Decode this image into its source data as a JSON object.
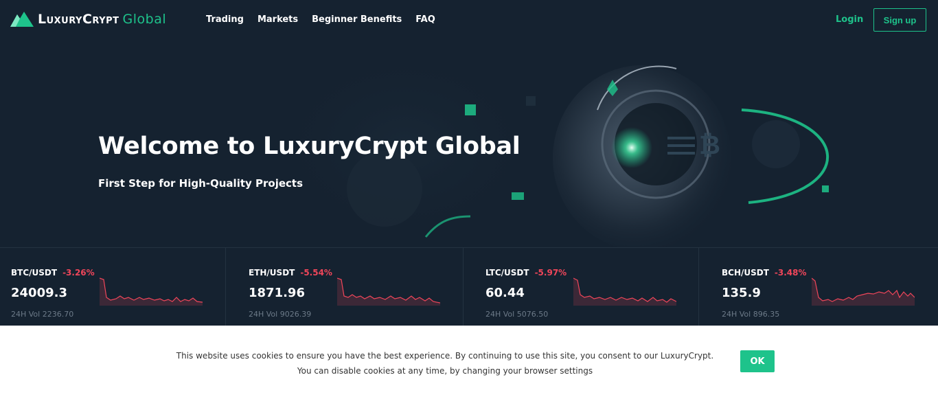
{
  "header": {
    "logo_brand": "LuxuryCrypt",
    "logo_accent": "Global",
    "nav": [
      {
        "label": "Trading"
      },
      {
        "label": "Markets"
      },
      {
        "label": "Beginner Benefits"
      },
      {
        "label": "FAQ"
      }
    ],
    "login_label": "Login",
    "signup_label": "Sign up"
  },
  "hero": {
    "title": "Welcome to LuxuryCrypt Global",
    "subtitle": "First Step for High-Quality Projects"
  },
  "tickers": [
    {
      "pair": "BTC/USDT",
      "change": "-3.26%",
      "price": "24009.3",
      "volume": "24H Vol 2236.70"
    },
    {
      "pair": "ETH/USDT",
      "change": "-5.54%",
      "price": "1871.96",
      "volume": "24H Vol 9026.39"
    },
    {
      "pair": "LTC/USDT",
      "change": "-5.97%",
      "price": "60.44",
      "volume": "24H Vol 5076.50"
    },
    {
      "pair": "BCH/USDT",
      "change": "-3.48%",
      "price": "135.9",
      "volume": "24H Vol 896.35"
    }
  ],
  "cookie": {
    "line1": "This website uses cookies to ensure you have the best experience. By continuing to use this site, you consent to our LuxuryCrypt.",
    "line2": "You can disable cookies at any time, by changing your browser settings",
    "ok_label": "OK"
  },
  "colors": {
    "background": "#152230",
    "accent": "#1ec38b",
    "negative": "#f0465a"
  }
}
